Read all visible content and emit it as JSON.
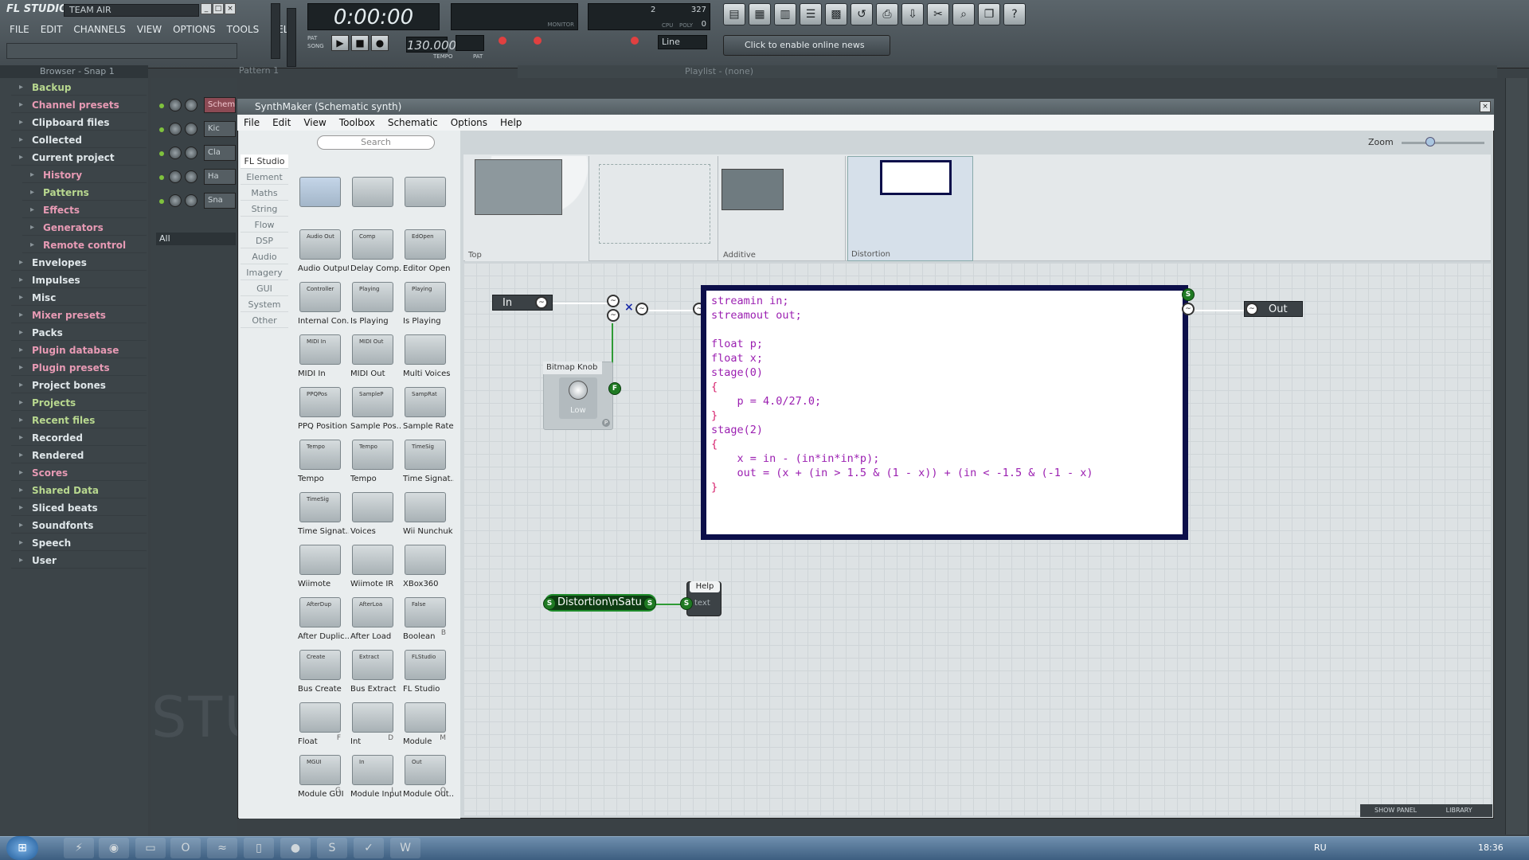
{
  "app": {
    "logo": "FL STUDIO",
    "title": "TEAM AIR",
    "win_buttons": [
      "_",
      "□",
      "×"
    ]
  },
  "menu": [
    "FILE",
    "EDIT",
    "CHANNELS",
    "VIEW",
    "OPTIONS",
    "TOOLS",
    "HELP"
  ],
  "transport": {
    "time": "0:00:00",
    "tempo": "130.000",
    "mode": "Line",
    "pattern_label": "PAT",
    "song_label": "SONG",
    "tempo_label": "TEMPO",
    "cpu_label": "CPU",
    "poly_label": "POLY",
    "monitor_label": "MONITOR",
    "counter": "2",
    "cpu_value": "327",
    "poly_value": "0",
    "play": "▶",
    "stop": "■",
    "rec": "●",
    "pat_label": "PAT"
  },
  "news": "Click to enable online news",
  "browser": {
    "title": "Browser - Snap 1",
    "items": [
      {
        "label": "Backup",
        "color": "green"
      },
      {
        "label": "Channel presets",
        "color": "pink"
      },
      {
        "label": "Clipboard files",
        "color": "white"
      },
      {
        "label": "Collected",
        "color": "white"
      },
      {
        "label": "Current project",
        "color": "white"
      },
      {
        "label": "History",
        "color": "pink",
        "sub": true
      },
      {
        "label": "Patterns",
        "color": "green",
        "sub": true
      },
      {
        "label": "Effects",
        "color": "pink",
        "sub": true
      },
      {
        "label": "Generators",
        "color": "pink",
        "sub": true
      },
      {
        "label": "Remote control",
        "color": "pink",
        "sub": true
      },
      {
        "label": "Envelopes",
        "color": "white"
      },
      {
        "label": "Impulses",
        "color": "white"
      },
      {
        "label": "Misc",
        "color": "white"
      },
      {
        "label": "Mixer presets",
        "color": "pink"
      },
      {
        "label": "Packs",
        "color": "white"
      },
      {
        "label": "Plugin database",
        "color": "pink"
      },
      {
        "label": "Plugin presets",
        "color": "pink"
      },
      {
        "label": "Project bones",
        "color": "white"
      },
      {
        "label": "Projects",
        "color": "green"
      },
      {
        "label": "Recent files",
        "color": "green"
      },
      {
        "label": "Recorded",
        "color": "white"
      },
      {
        "label": "Rendered",
        "color": "white"
      },
      {
        "label": "Scores",
        "color": "pink"
      },
      {
        "label": "Shared Data",
        "color": "green"
      },
      {
        "label": "Sliced beats",
        "color": "white"
      },
      {
        "label": "Soundfonts",
        "color": "white"
      },
      {
        "label": "Speech",
        "color": "white"
      },
      {
        "label": "User",
        "color": "white"
      }
    ]
  },
  "rack": {
    "pattern": "Pattern 1",
    "channels": [
      "Schemat",
      "Kic",
      "Cla",
      "Ha",
      "Sna"
    ],
    "filter": "All",
    "watermark": "STU"
  },
  "playlist": {
    "title": "Playlist - (none)"
  },
  "synthmaker": {
    "title": "SynthMaker (Schematic synth)",
    "menu": [
      "File",
      "Edit",
      "View",
      "Toolbox",
      "Schematic",
      "Options",
      "Help"
    ],
    "search_placeholder": "Search",
    "categories": [
      "FL Studio",
      "Element",
      "Maths",
      "String",
      "Flow",
      "DSP",
      "Audio",
      "Imagery",
      "GUI",
      "System",
      "Other"
    ],
    "components": [
      {
        "label": "",
        "mini": ""
      },
      {
        "label": "",
        "mini": ""
      },
      {
        "label": "",
        "mini": ""
      },
      {
        "label": "Audio Output",
        "mini": "Audio Out"
      },
      {
        "label": "Delay Comp...",
        "mini": "Comp"
      },
      {
        "label": "Editor Open",
        "mini": "EdOpen"
      },
      {
        "label": "Internal Con...",
        "mini": "Controller"
      },
      {
        "label": "Is Playing",
        "mini": "Playing"
      },
      {
        "label": "Is Playing",
        "mini": "Playing"
      },
      {
        "label": "MIDI In",
        "mini": "MIDI In"
      },
      {
        "label": "MIDI Out",
        "mini": "MIDI Out"
      },
      {
        "label": "Multi Voices",
        "mini": ""
      },
      {
        "label": "PPQ Position",
        "mini": "PPQPos"
      },
      {
        "label": "Sample Pos...",
        "mini": "SampleP"
      },
      {
        "label": "Sample Rate",
        "mini": "SampRat"
      },
      {
        "label": "Tempo",
        "mini": "Tempo"
      },
      {
        "label": "Tempo",
        "mini": "Tempo"
      },
      {
        "label": "Time Signat...",
        "mini": "TimeSig"
      },
      {
        "label": "Time Signat...",
        "mini": "TimeSig"
      },
      {
        "label": "Voices",
        "mini": ""
      },
      {
        "label": "Wii Nunchuk",
        "mini": ""
      },
      {
        "label": "Wiimote",
        "mini": ""
      },
      {
        "label": "Wiimote IR",
        "mini": ""
      },
      {
        "label": "XBox360",
        "mini": ""
      },
      {
        "label": "After Duplic...",
        "mini": "AfterDup"
      },
      {
        "label": "After Load",
        "mini": "AfterLoa"
      },
      {
        "label": "Boolean",
        "mini": "False",
        "letter": "B"
      },
      {
        "label": "Bus Create",
        "mini": "Create"
      },
      {
        "label": "Bus Extract",
        "mini": "Extract"
      },
      {
        "label": "FL Studio",
        "mini": "FLStudio"
      },
      {
        "label": "Float",
        "mini": "",
        "letter": "F"
      },
      {
        "label": "Int",
        "mini": "",
        "letter": "D"
      },
      {
        "label": "Module",
        "mini": "",
        "letter": "M"
      },
      {
        "label": "Module GUI",
        "mini": "MGUI",
        "letter": "G"
      },
      {
        "label": "Module Input",
        "mini": "In",
        "letter": "I"
      },
      {
        "label": "Module Out...",
        "mini": "Out",
        "letter": "O"
      }
    ],
    "navigator": [
      {
        "label": "Top"
      },
      {
        "label": ""
      },
      {
        "label": "Additive"
      },
      {
        "label": "Distortion"
      }
    ],
    "zoom_label": "Zoom",
    "nodes": {
      "in": "In",
      "out": "Out",
      "knob_title": "Bitmap Knob",
      "knob_value": "Low",
      "string_value": "Distortion\\nSatu",
      "help_title": "Help",
      "help_text": "text",
      "mult": "×"
    },
    "code": [
      "streamin in;",
      "streamout out;",
      "",
      "float p;",
      "float x;",
      "stage(0)",
      "{",
      "    p = 4.0/27.0;",
      "}",
      "stage(2)",
      "{",
      "    x = in - (in*in*in*p);",
      "    out = (x + (in > 1.5 & (1 - x)) + (in < -1.5 & (-1 - x)",
      "}"
    ],
    "show_panel": "SHOW PANEL",
    "library": "LIBRARY"
  },
  "taskbar": {
    "lang": "RU",
    "clock": "18:36"
  }
}
